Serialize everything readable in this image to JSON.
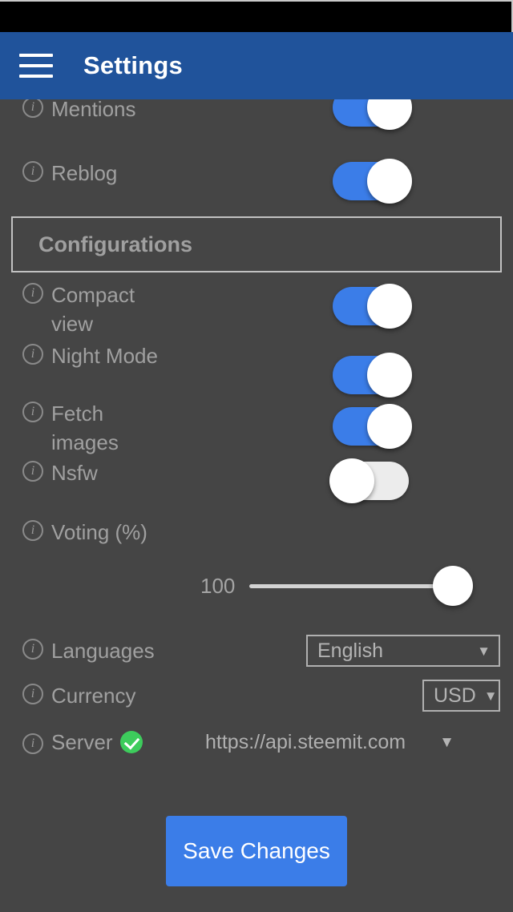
{
  "app_bar": {
    "title": "Settings",
    "menu_icon": "hamburger-menu-icon",
    "background_color": "#20539B"
  },
  "theme": {
    "page_background": "#454545",
    "accent_blue": "#3B7DE8",
    "label_color": "#a0a0a0",
    "success_green": "#3DCC5C",
    "status_bar_color": "#000000"
  },
  "notification_settings": {
    "rows": [
      {
        "label": "Mentions",
        "info_icon": "info-icon",
        "toggle": "on"
      },
      {
        "label": "Reblog",
        "info_icon": "info-icon",
        "toggle": "on"
      }
    ]
  },
  "section": {
    "title": "Configurations"
  },
  "configurations": {
    "toggle_rows": [
      {
        "label": "Compact view",
        "info_icon": "info-icon",
        "toggle": "on"
      },
      {
        "label": "Night Mode",
        "info_icon": "info-icon",
        "toggle": "on"
      },
      {
        "label": "Fetch images",
        "info_icon": "info-icon",
        "toggle": "on"
      },
      {
        "label": "Nsfw",
        "info_icon": "info-icon",
        "toggle": "off"
      }
    ],
    "voting": {
      "label": "Voting (%)",
      "info_icon": "info-icon",
      "value": "100",
      "min": 0,
      "max": 100,
      "percent": 100
    },
    "languages": {
      "label": "Languages",
      "info_icon": "info-icon",
      "selected": "English",
      "caret_icon": "chevron-down-icon"
    },
    "currency": {
      "label": "Currency",
      "info_icon": "info-icon",
      "selected": "USD",
      "caret_icon": "chevron-down-icon"
    },
    "server": {
      "label": "Server",
      "info_icon": "info-icon",
      "status_icon": "check-circle-icon",
      "selected": "https://api.steemit.com",
      "caret_icon": "chevron-down-icon"
    }
  },
  "footer": {
    "save_label": "Save Changes"
  },
  "glyphs": {
    "info": "i",
    "caret_down": "▼"
  }
}
